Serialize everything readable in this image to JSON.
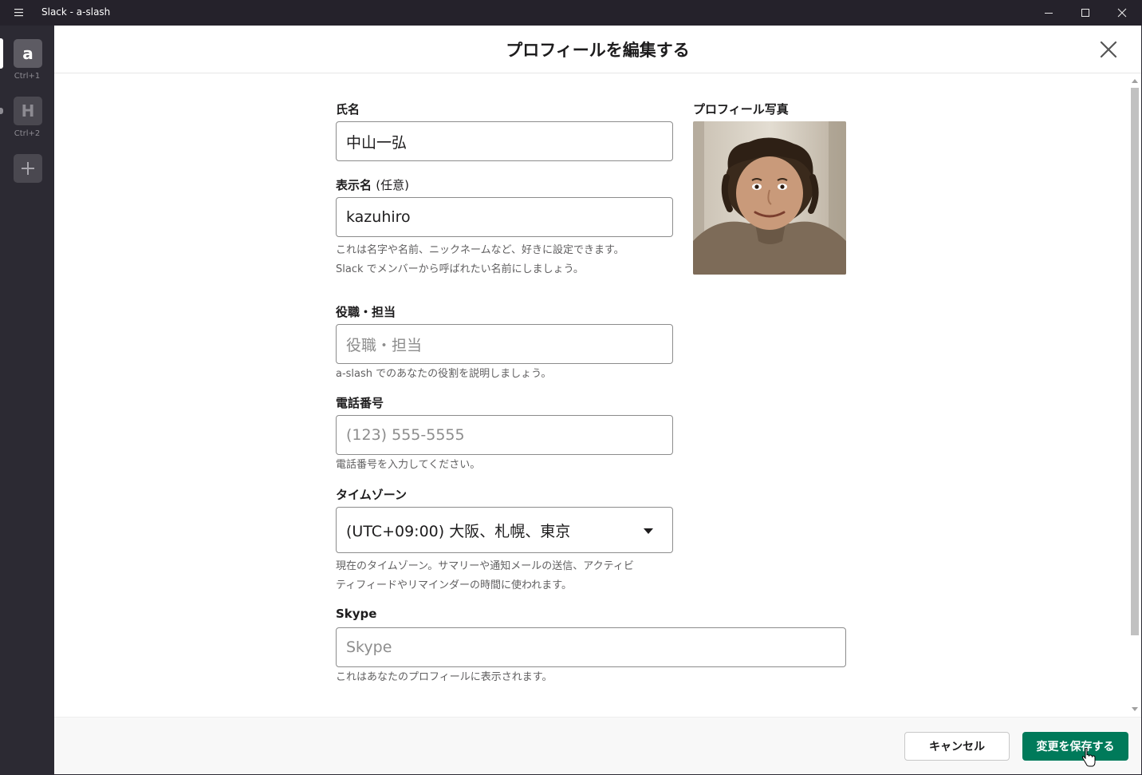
{
  "window": {
    "title": "Slack - a-slash"
  },
  "sidebar": {
    "workspaces": [
      {
        "initial": "a",
        "shortcut": "Ctrl+1"
      },
      {
        "initial": "H",
        "shortcut": "Ctrl+2"
      }
    ],
    "add_label": "+"
  },
  "modal": {
    "title": "プロフィールを編集する",
    "full_name": {
      "label": "氏名",
      "value": "中山一弘"
    },
    "display_name": {
      "label": "表示名",
      "label_optional": "(任意)",
      "value": "kazuhiro",
      "hint_line1": "これは名字や名前、ニックネームなど、好きに設定できます。",
      "hint_line2": "Slack でメンバーから呼ばれたい名前にしましょう。"
    },
    "role": {
      "label": "役職・担当",
      "placeholder": "役職・担当",
      "hint": "a-slash でのあなたの役割を説明しましょう。"
    },
    "phone": {
      "label": "電話番号",
      "placeholder": "(123) 555-5555",
      "hint": "電話番号を入力してください。"
    },
    "timezone": {
      "label": "タイムゾーン",
      "value": "(UTC+09:00) 大阪、札幌、東京",
      "hint_line1": "現在のタイムゾーン。サマリーや通知メールの送信、アクティビ",
      "hint_line2": "ティフィードやリマインダーの時間に使われます。"
    },
    "skype": {
      "label": "Skype",
      "placeholder": "Skype",
      "hint": "これはあなたのプロフィールに表示されます。"
    },
    "photo": {
      "label": "プロフィール写真"
    },
    "footer": {
      "cancel_label": "キャンセル",
      "save_label": "変更を保存する"
    }
  },
  "colors": {
    "save_button": "#007a5a",
    "sidebar_bg": "#2c2a33"
  }
}
